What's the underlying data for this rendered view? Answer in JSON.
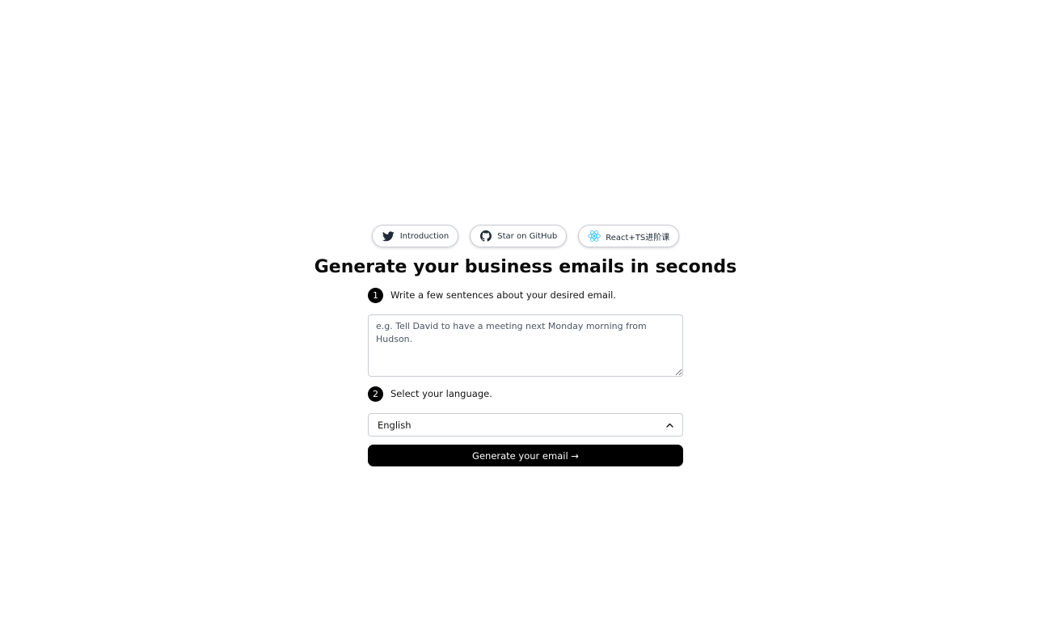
{
  "links": [
    {
      "label": "Introduction",
      "icon": "twitter-icon"
    },
    {
      "label": "Star on GitHub",
      "icon": "github-icon"
    },
    {
      "label": "React+TS进阶课",
      "icon": "react-icon"
    }
  ],
  "headline": "Generate your business emails in seconds",
  "step1": {
    "number": "1",
    "text": "Write a few sentences about your desired email.",
    "placeholder": "e.g. Tell David to have a meeting next Monday morning from Hudson.",
    "value": ""
  },
  "step2": {
    "number": "2",
    "text": "Select your language.",
    "selected": "English"
  },
  "generate_button": "Generate your email →",
  "colors": {
    "twitter": "#1d9bf0",
    "react": "#22c3f2",
    "button_bg": "#000000"
  }
}
